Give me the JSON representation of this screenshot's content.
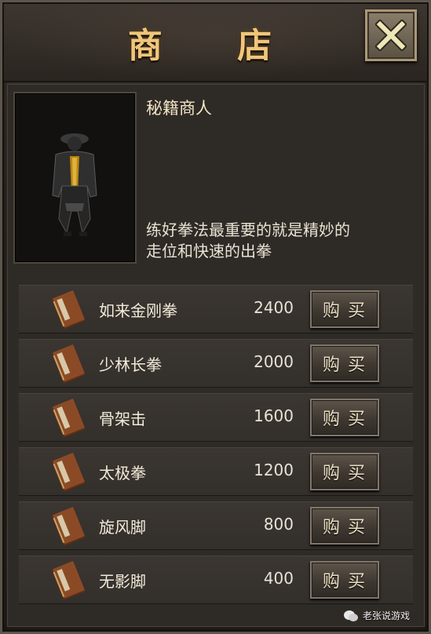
{
  "shop": {
    "title": "商 店",
    "npc": {
      "name": "秘籍商人",
      "description": "练好拳法最重要的就是精妙的走位和快速的出拳"
    },
    "items": [
      {
        "name": "如来金刚拳",
        "price": "2400",
        "buy_label": "购买"
      },
      {
        "name": "少林长拳",
        "price": "2000",
        "buy_label": "购买"
      },
      {
        "name": "骨架击",
        "price": "1600",
        "buy_label": "购买"
      },
      {
        "name": "太极拳",
        "price": "1200",
        "buy_label": "购买"
      },
      {
        "name": "旋风脚",
        "price": "800",
        "buy_label": "购买"
      },
      {
        "name": "无影脚",
        "price": "400",
        "buy_label": "购买"
      }
    ]
  },
  "watermark": {
    "text": "老张说游戏"
  },
  "colors": {
    "title": "#f0c679",
    "book": "#8b4a26",
    "close_x": "#efe6b8"
  }
}
